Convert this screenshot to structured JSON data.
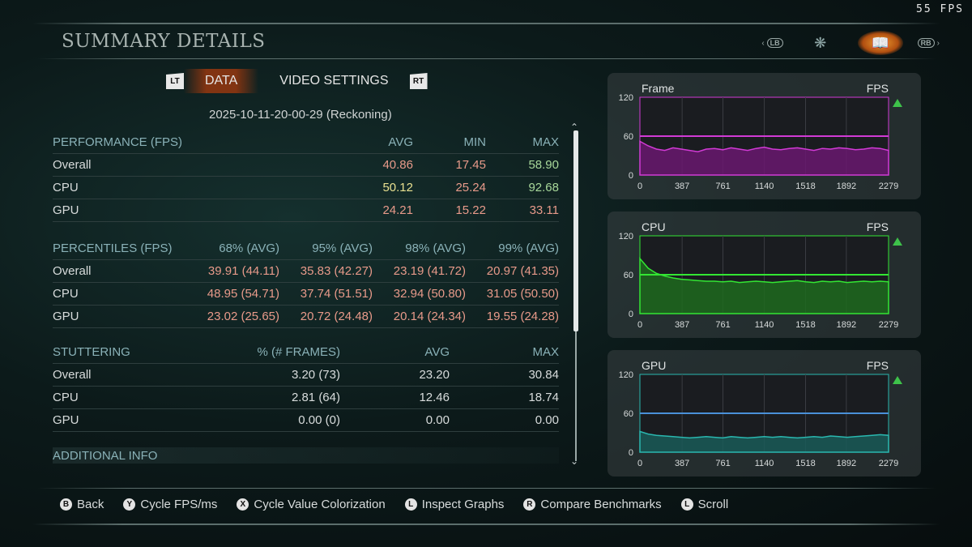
{
  "overlay": {
    "fps_counter": "55 FPS"
  },
  "header": {
    "title": "SUMMARY DETAILS",
    "lb": "LB",
    "rb": "RB"
  },
  "tabs": {
    "lt": "LT",
    "rt": "RT",
    "items": [
      {
        "label": "DATA",
        "active": true
      },
      {
        "label": "VIDEO SETTINGS",
        "active": false
      }
    ]
  },
  "run_label": "2025-10-11-20-00-29 (Reckoning)",
  "performance": {
    "headers": [
      "PERFORMANCE (FPS)",
      "AVG",
      "MIN",
      "MAX"
    ],
    "rows": [
      {
        "label": "Overall",
        "avg": "40.86",
        "min": "17.45",
        "max": "58.90"
      },
      {
        "label": "CPU",
        "avg": "50.12",
        "min": "25.24",
        "max": "92.68"
      },
      {
        "label": "GPU",
        "avg": "24.21",
        "min": "15.22",
        "max": "33.11"
      }
    ]
  },
  "percentiles": {
    "headers": [
      "PERCENTILES (FPS)",
      "68% (AVG)",
      "95% (AVG)",
      "98% (AVG)",
      "99% (AVG)"
    ],
    "rows": [
      {
        "label": "Overall",
        "p68": "39.91 (44.11)",
        "p95": "35.83 (42.27)",
        "p98": "23.19 (41.72)",
        "p99": "20.97 (41.35)"
      },
      {
        "label": "CPU",
        "p68": "48.95 (54.71)",
        "p95": "37.74 (51.51)",
        "p98": "32.94 (50.80)",
        "p99": "31.05 (50.50)"
      },
      {
        "label": "GPU",
        "p68": "23.02 (25.65)",
        "p95": "20.72 (24.48)",
        "p98": "20.14 (24.34)",
        "p99": "19.55 (24.28)"
      }
    ]
  },
  "stuttering": {
    "headers": [
      "STUTTERING",
      "% (# FRAMES)",
      "AVG",
      "MAX"
    ],
    "rows": [
      {
        "label": "Overall",
        "pct": "3.20 (73)",
        "avg": "23.20",
        "max": "30.84"
      },
      {
        "label": "CPU",
        "pct": "2.81 (64)",
        "avg": "12.46",
        "max": "18.74"
      },
      {
        "label": "GPU",
        "pct": "0.00 (0)",
        "avg": "0.00",
        "max": "0.00"
      }
    ]
  },
  "additional_info": "ADDITIONAL INFO",
  "colors": {
    "avg_overall": "#e89a8a",
    "min_overall": "#e89a8a",
    "max_overall": "#a8d89a",
    "avg_cpu": "#e8e090",
    "min_cpu": "#e89a8a",
    "max_cpu": "#a8d89a",
    "avg_gpu": "#e89a8a",
    "min_gpu": "#e89a8a",
    "max_gpu": "#e89a8a",
    "pct": "#e89a8a",
    "frame_line": "#d23ad6",
    "cpu_line": "#33e633",
    "gpu_line": "#2ab8b0"
  },
  "chart_data": [
    {
      "type": "line",
      "title": "Frame",
      "ylabel": "FPS",
      "ylim": [
        0,
        120
      ],
      "yticks": [
        0,
        60,
        120
      ],
      "xticks": [
        0,
        387,
        761,
        1140,
        1518,
        1892,
        2279
      ],
      "xlim": [
        0,
        2279
      ],
      "reference_line": 60,
      "mean": 41,
      "series": [
        {
          "values": [
            52,
            45,
            40,
            38,
            42,
            40,
            38,
            36,
            40,
            41,
            39,
            42,
            40,
            38,
            41,
            43,
            40,
            39,
            41,
            42,
            40,
            38,
            41,
            40,
            42,
            41,
            39,
            40,
            42,
            41,
            38
          ]
        }
      ]
    },
    {
      "type": "line",
      "title": "CPU",
      "ylabel": "FPS",
      "ylim": [
        0,
        120
      ],
      "yticks": [
        0,
        60,
        120
      ],
      "xticks": [
        0,
        387,
        761,
        1140,
        1518,
        1892,
        2279
      ],
      "xlim": [
        0,
        2279
      ],
      "reference_line": 60,
      "mean": 50,
      "series": [
        {
          "values": [
            85,
            70,
            62,
            58,
            55,
            53,
            52,
            51,
            50,
            50,
            49,
            50,
            48,
            49,
            50,
            49,
            48,
            49,
            50,
            51,
            49,
            48,
            50,
            49,
            50,
            48,
            49,
            50,
            49,
            50,
            49
          ]
        }
      ]
    },
    {
      "type": "line",
      "title": "GPU",
      "ylabel": "FPS",
      "ylim": [
        0,
        120
      ],
      "yticks": [
        0,
        60,
        120
      ],
      "xticks": [
        0,
        387,
        761,
        1140,
        1518,
        1892,
        2279
      ],
      "xlim": [
        0,
        2279
      ],
      "reference_line": 60,
      "mean": 24,
      "series": [
        {
          "values": [
            32,
            28,
            26,
            25,
            24,
            23,
            22,
            23,
            24,
            23,
            22,
            24,
            23,
            22,
            23,
            24,
            23,
            24,
            23,
            22,
            23,
            24,
            23,
            25,
            24,
            23,
            24,
            25,
            26,
            27,
            26
          ]
        }
      ]
    }
  ],
  "footer": [
    {
      "glyph": "B",
      "label": "Back"
    },
    {
      "glyph": "Y",
      "label": "Cycle FPS/ms"
    },
    {
      "glyph": "X",
      "label": "Cycle Value Colorization"
    },
    {
      "glyph": "L",
      "label": "Inspect Graphs"
    },
    {
      "glyph": "R",
      "label": "Compare Benchmarks"
    },
    {
      "glyph": "L",
      "label": "Scroll"
    }
  ]
}
